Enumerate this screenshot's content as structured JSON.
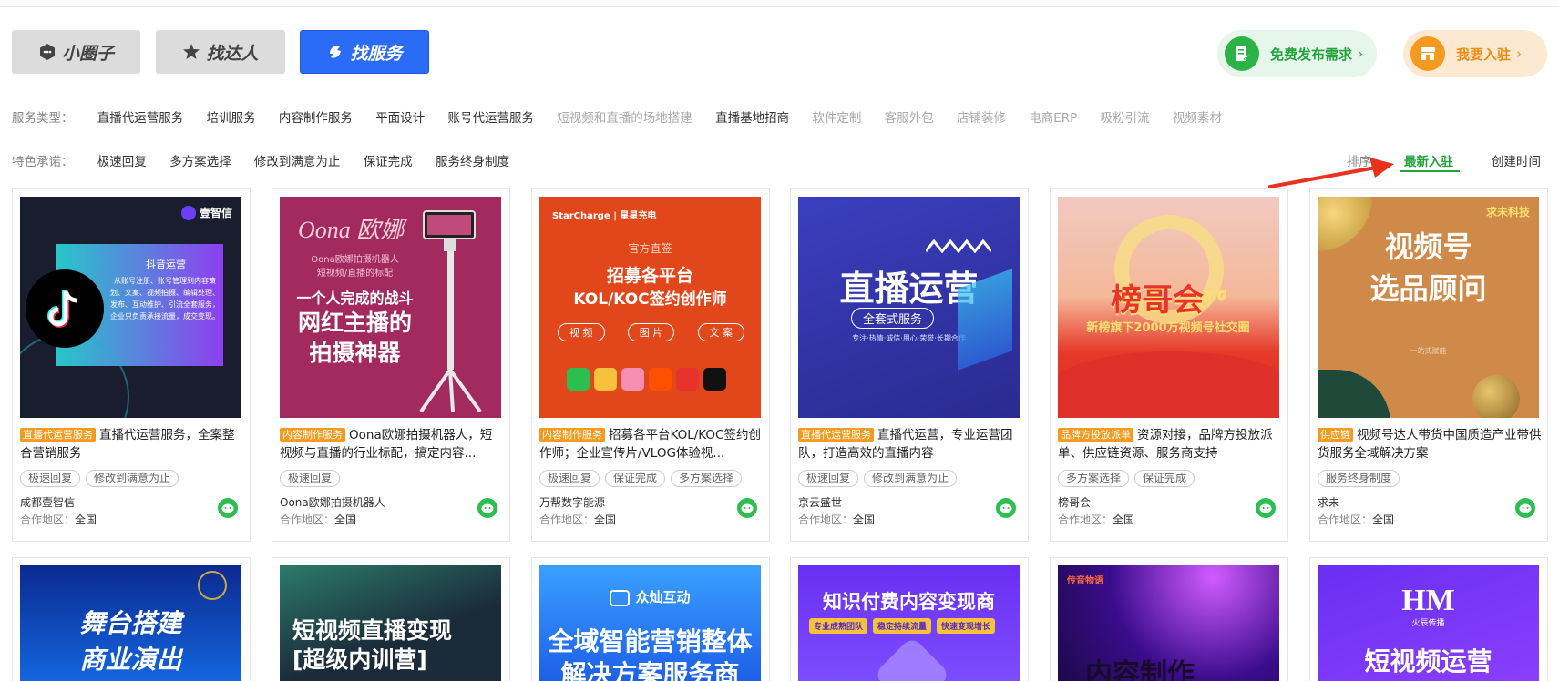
{
  "tabs": [
    {
      "label": "小圈子"
    },
    {
      "label": "找达人"
    },
    {
      "label": "找服务"
    }
  ],
  "actions": {
    "publish": "免费发布需求",
    "join": "我要入驻"
  },
  "filters": {
    "service_type_label": "服务类型：",
    "service_types": [
      "直播代运营服务",
      "培训服务",
      "内容制作服务",
      "平面设计",
      "账号代运营服务",
      "短视频和直播的场地搭建",
      "直播基地招商",
      "软件定制",
      "客服外包",
      "店铺装修",
      "电商ERP",
      "吸粉引流",
      "视频素材"
    ],
    "promise_label": "特色承诺：",
    "promises": [
      "极速回复",
      "多方案选择",
      "修改到满意为止",
      "保证完成",
      "服务终身制度"
    ]
  },
  "sort": {
    "label": "排序",
    "newest": "最新入驻",
    "created": "创建时间"
  },
  "area_label": "合作地区：",
  "cards": [
    {
      "tag": "直播代运营服务",
      "title": "直播代运营服务，全案整合营销服务",
      "chips": [
        "极速回复",
        "修改到满意为止"
      ],
      "company": "成都壹智信",
      "area": "全国",
      "img": {
        "brand": "壹智信",
        "heading": "抖音运营",
        "body": "从账号注册、账号管理到内容策划、文案、视频拍摄、编辑处理、发布、互动维护、引流全套服务，企业只负责承接流量，成交变现。"
      }
    },
    {
      "tag": "内容制作服务",
      "title": "Oona欧娜拍摄机器人，短视频与直播的行业标配，搞定内容...",
      "chips": [
        "极速回复"
      ],
      "company": "Oona欧娜拍摄机器人",
      "area": "全国",
      "img": {
        "brand": "Oona 欧娜",
        "sub1": "Oona欧娜拍摄机器人",
        "sub2": "短视频/直播的标配",
        "line1": "一个人完成的战斗",
        "line2": "网红主播的",
        "line3": "拍摄神器"
      }
    },
    {
      "tag": "内容制作服务",
      "title": "招募各平台KOL/KOC签约创作师；企业宣传片/VLOG体验视...",
      "chips": [
        "极速回复",
        "保证完成",
        "多方案选择"
      ],
      "company": "万帮数字能源",
      "area": "全国",
      "img": {
        "brand": "StarCharge | 星星充电",
        "sub": "官方直签",
        "line1": "招募各平台",
        "line2": "KOL/KOC签约创作师",
        "pills": [
          "视 频",
          "图 片",
          "文 案"
        ]
      }
    },
    {
      "tag": "直播代运营服务",
      "title": "直播代运营，专业运营团队，打造高效的直播内容",
      "chips": [
        "极速回复",
        "修改到满意为止"
      ],
      "company": "京云盛世",
      "area": "全国",
      "img": {
        "line1": "直播运营",
        "pill": "全套式服务",
        "sub": "专注·热情·诚信·用心·荣誉·长期合作"
      }
    },
    {
      "tag": "品牌方投放派单",
      "title": "资源对接，品牌方投放派单、供应链资源、服务商支持",
      "chips": [
        "多方案选择",
        "保证完成"
      ],
      "company": "榜哥会",
      "area": "全国",
      "img": {
        "line1": "榜哥会",
        "ver": "2.0",
        "sub": "新榜旗下2000万视频号社交圈"
      }
    },
    {
      "tag": "供应链",
      "title": "视频号达人带货中国质造产业带供货服务全域解决方案",
      "chips": [
        "服务终身制度"
      ],
      "company": "求未",
      "area": "全国",
      "img": {
        "brand": "求未科技",
        "line1": "视频号",
        "line2": "选品顾问",
        "sub": "一站式赋能"
      }
    }
  ],
  "row2": [
    {
      "line1": "舞台搭建",
      "line2": "商业演出"
    },
    {
      "line1": "短视频直播变现",
      "line2": "[超级内训营]"
    },
    {
      "brand": "众灿互动",
      "line1": "全域智能营销整体",
      "line2": "解决方案服务商"
    },
    {
      "line1": "知识付费内容变现商",
      "pills": [
        "专业成熟团队",
        "稳定持续流量",
        "快速变现增长"
      ]
    },
    {
      "brand": "传音物语",
      "line1": "内容制作"
    },
    {
      "brand": "火辰传播",
      "line1": "短视频运营"
    }
  ]
}
